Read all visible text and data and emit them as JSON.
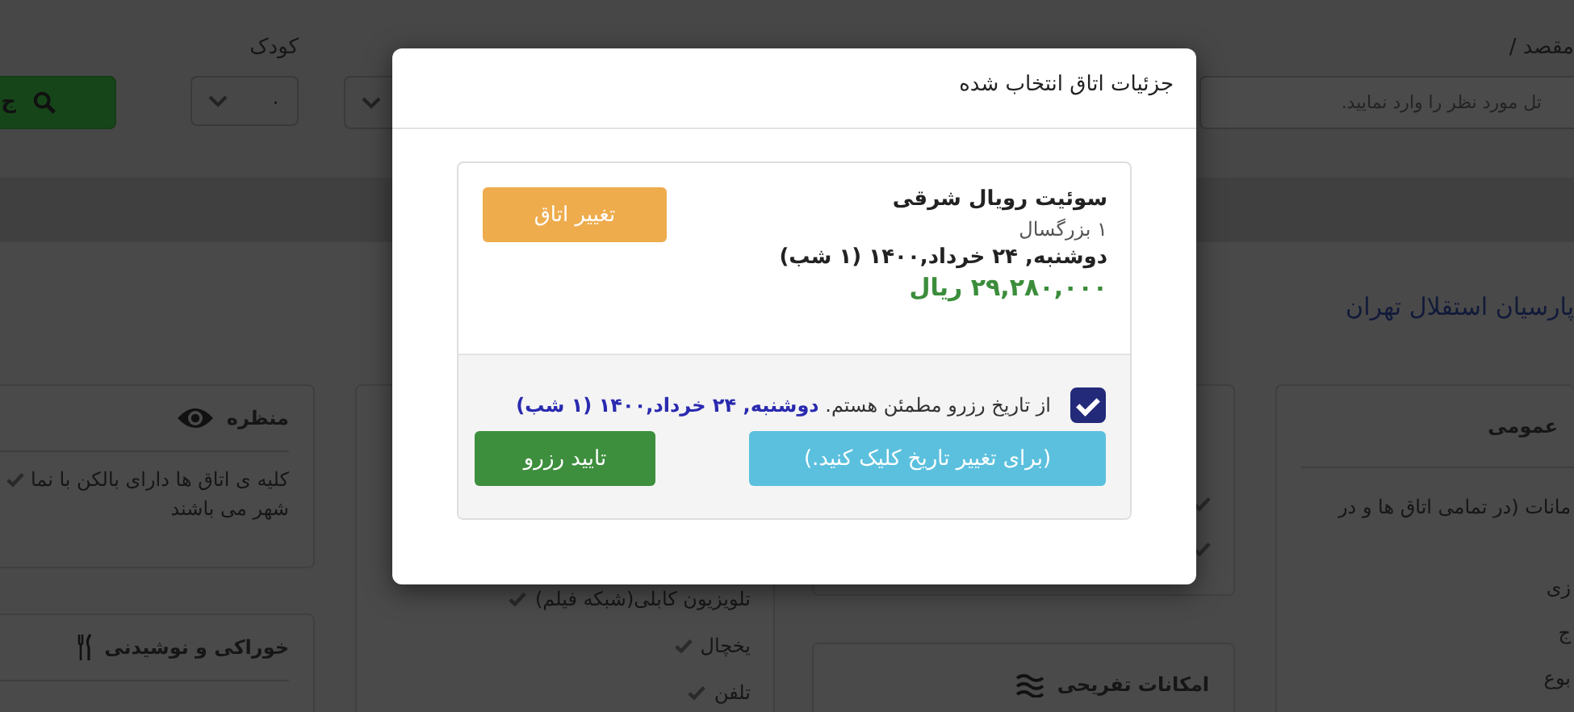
{
  "search_bar": {
    "destination_label": "مقصد /",
    "destination_placeholder": "تل مورد نظر را وارد نمایید.",
    "child_label": "کودک",
    "child_value": "۰",
    "search_button": "ج"
  },
  "hotel_title": "پارسیان استقلال تهران",
  "view_card": {
    "title": "منظره",
    "lines": [
      "کلیه ی اتاق ها دارای بالکن با نما",
      "شهر می باشند"
    ]
  },
  "food_card": {
    "title": "خوراکی و نوشیدنی"
  },
  "room_amenities": {
    "items": [
      "تلویزیون کابلی(شبکه فیلم)",
      "یخچال",
      "تلفن"
    ]
  },
  "entertainment_card": {
    "title": "امکانات تفریحی"
  },
  "general_card": {
    "title": "عمومی",
    "lines": [
      "مانات (در تمامی اتاق ها و در",
      "زی",
      "ج",
      "بوع"
    ]
  },
  "modal": {
    "title": "جزئیات اتاق انتخاب شده",
    "room_name": "سوئیت رویال شرقی",
    "guests": "۱ بزرگسال",
    "dates": "دوشنبه, ۲۴ خرداد,۱۴۰۰ (۱ شب)",
    "price": "۲۹,۲۸۰,۰۰۰ ریال",
    "change_room_button": "تغییر اتاق",
    "confirm": {
      "checked": true,
      "text": "از تاریخ رزرو مطمئن هستم. **دوشنبه, ۲۴ خرداد,۱۴۰۰ (۱ شب)**"
    },
    "change_date_button": "(برای تغییر تاریخ کلیک کنید.)",
    "book_button": "تایید رزرو"
  }
}
